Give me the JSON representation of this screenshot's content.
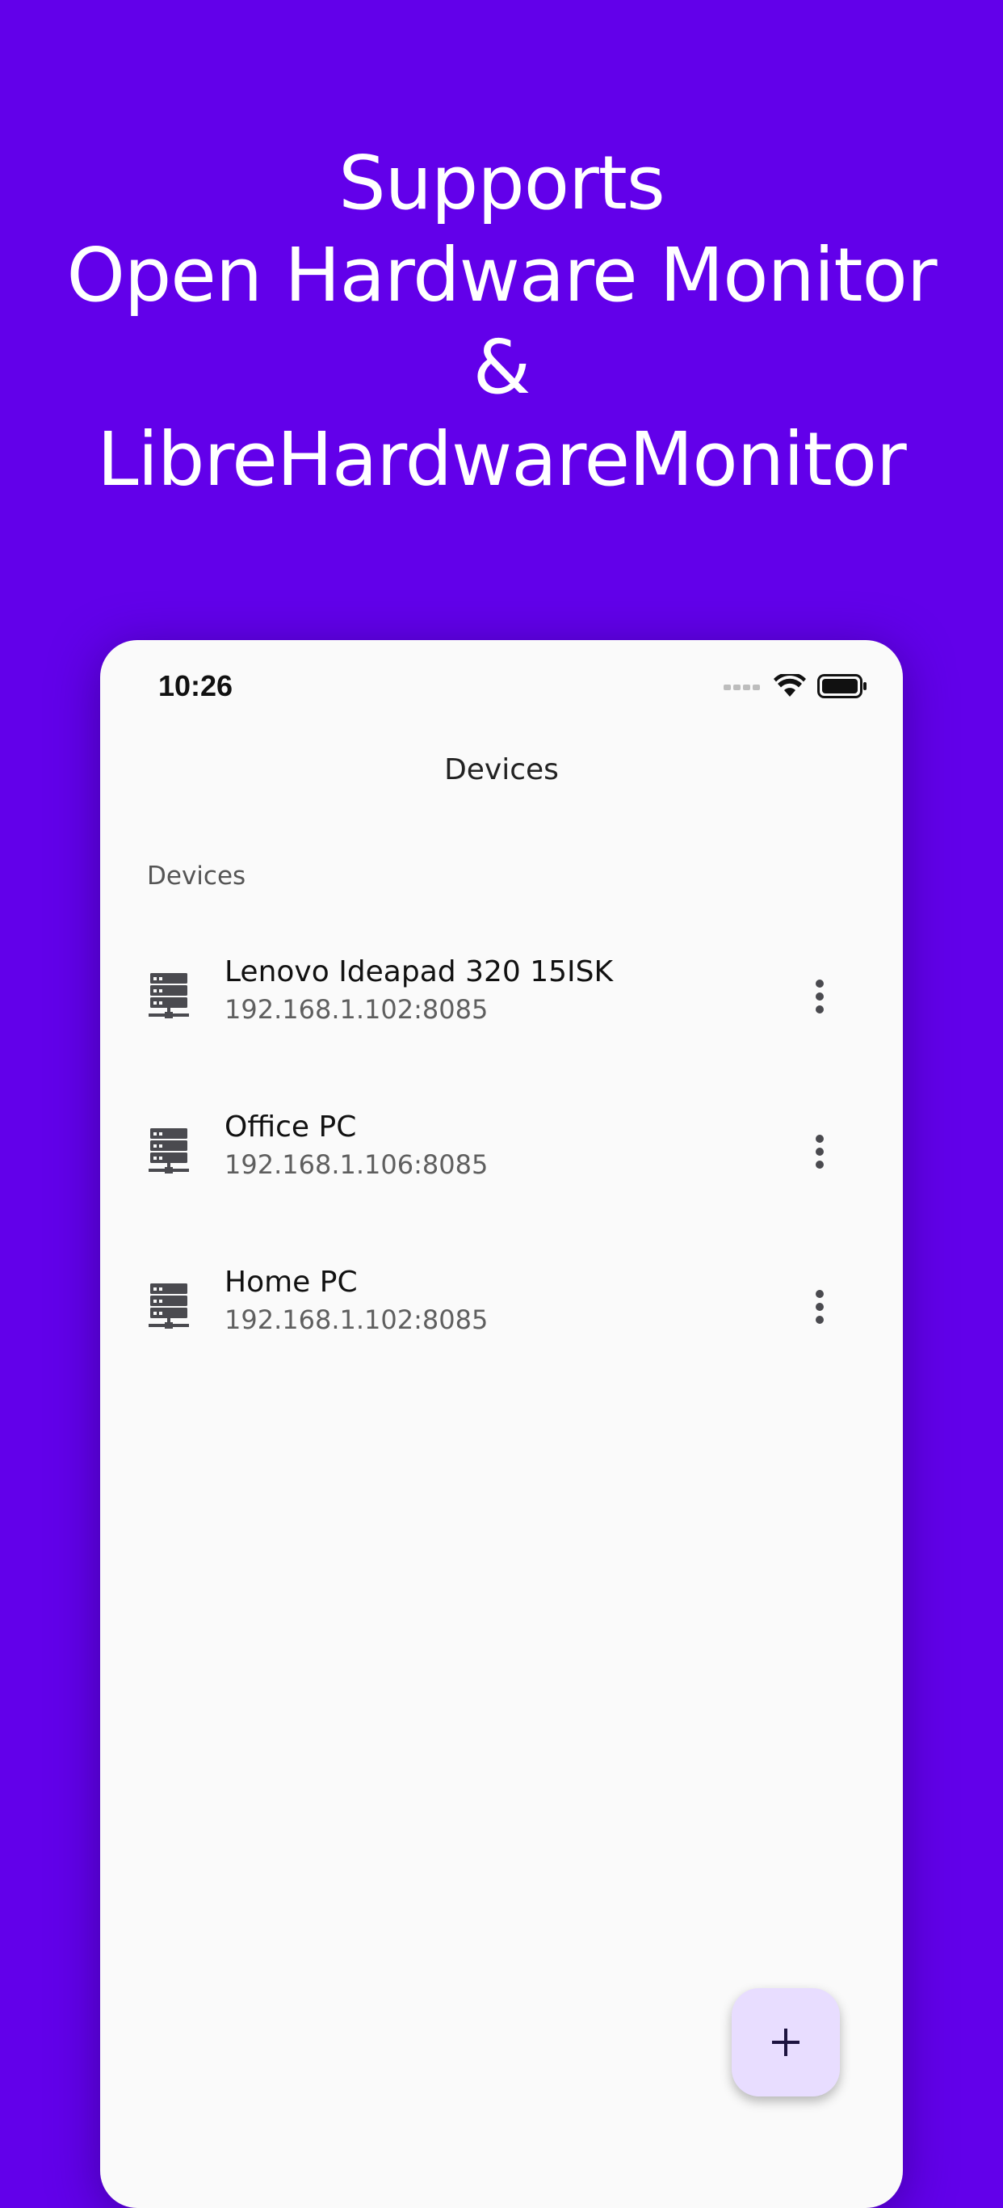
{
  "promo": {
    "line1": "Supports",
    "line2": "Open Hardware Monitor",
    "line3": "&",
    "line4": "LibreHardwareMonitor"
  },
  "status_bar": {
    "time": "10:26",
    "icons": [
      "signal-icon",
      "wifi-icon",
      "battery-icon"
    ]
  },
  "app_bar": {
    "title": "Devices"
  },
  "section": {
    "label": "Devices"
  },
  "devices": [
    {
      "name": "Lenovo Ideapad 320 15ISK",
      "address": "192.168.1.102:8085",
      "icon": "server-icon",
      "action_icon": "more-vert-icon"
    },
    {
      "name": "Office PC",
      "address": "192.168.1.106:8085",
      "icon": "server-icon",
      "action_icon": "more-vert-icon"
    },
    {
      "name": "Home PC",
      "address": "192.168.1.102:8085",
      "icon": "server-icon",
      "action_icon": "more-vert-icon"
    }
  ],
  "fab": {
    "icon": "add-icon"
  },
  "colors": {
    "background": "#6200ea",
    "surface": "#fafafa",
    "fab": "#e8ddff",
    "icon": "#4a4a4f"
  }
}
